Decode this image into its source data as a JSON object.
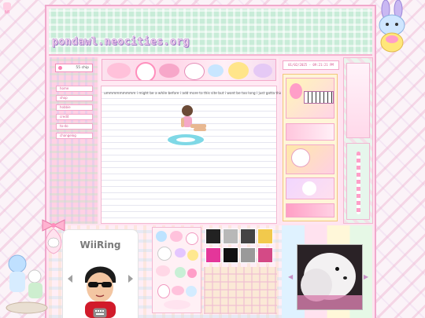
{
  "site": {
    "title": "pondawl.neocities.org",
    "mini_logo": "BB"
  },
  "counter": {
    "value": "55 chip"
  },
  "nav": {
    "items": [
      {
        "label": "home"
      },
      {
        "label": "shop"
      },
      {
        "label": "hobbie"
      },
      {
        "label": "credit"
      },
      {
        "label": "to-do"
      },
      {
        "label": "changelog"
      }
    ]
  },
  "post": {
    "text": "ummmmmmmmm i might be a while before i add more to this site but i wont be too long i just gotta think"
  },
  "datetime": {
    "value": "01/02/2025 - 09:21:21 PM"
  },
  "wii": {
    "title": "WiiRing"
  },
  "colors": {
    "pink_border": "#f0a9cc",
    "header_green": "#c8ecd8",
    "nav_text": "#d6558f",
    "card_bg": "#fff5d8"
  },
  "icons": {
    "prev": "chevron-left-icon",
    "next": "chevron-right-icon",
    "keyboard": "keyboard-icon"
  }
}
